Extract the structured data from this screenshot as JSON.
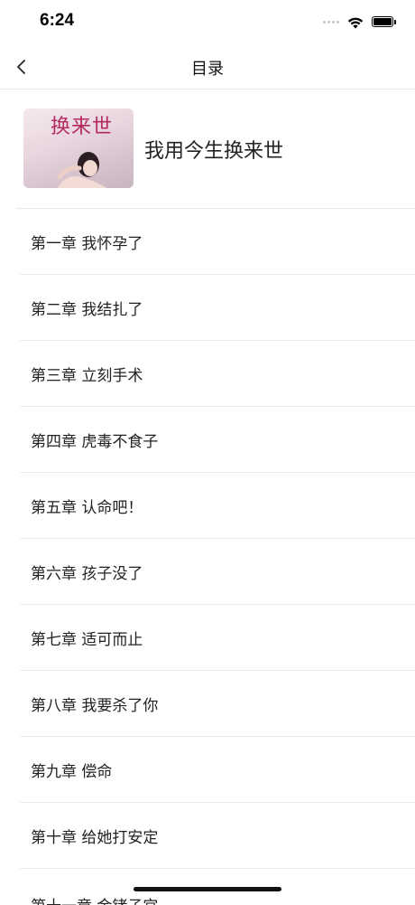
{
  "status_bar": {
    "time": "6:24"
  },
  "nav": {
    "title": "目录",
    "back_icon": "chevron-left-icon"
  },
  "book": {
    "title": "我用今生换来世",
    "cover_text": "换来世"
  },
  "chapters": [
    {
      "label": "第一章 我怀孕了"
    },
    {
      "label": "第二章 我结扎了"
    },
    {
      "label": "第三章 立刻手术"
    },
    {
      "label": "第四章 虎毒不食子"
    },
    {
      "label": "第五章 认命吧！"
    },
    {
      "label": "第六章 孩子没了"
    },
    {
      "label": "第七章 适可而止"
    },
    {
      "label": "第八章 我要杀了你"
    },
    {
      "label": "第九章 偿命"
    },
    {
      "label": "第十章 给她打安定"
    },
    {
      "label": "第十一章 金铐子宫"
    }
  ]
}
